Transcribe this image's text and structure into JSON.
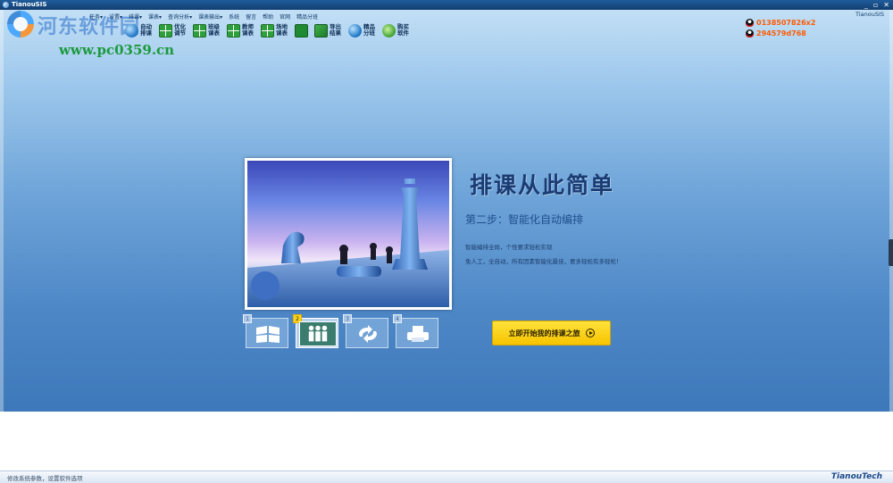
{
  "window": {
    "title": "TianouSIS",
    "brand_top": "TianouSIS",
    "minimize": "_",
    "restore": "▫",
    "close": "✕"
  },
  "watermark": {
    "name": "河东软件园",
    "url": "www.pc0359.cn"
  },
  "menu": {
    "items": [
      "任务▾",
      "设置▾",
      "排课▾",
      "课表▾",
      "查询分析▾",
      "课表输出▾",
      "系统",
      "留言",
      "帮助",
      "官网",
      "精品分班"
    ]
  },
  "toolbar": {
    "items": [
      {
        "label": "自动排课",
        "icon": "globe-icon"
      },
      {
        "label": "优化调节",
        "icon": "grid-icon"
      },
      {
        "label": "班级课表",
        "icon": "grid-icon"
      },
      {
        "label": "教师课表",
        "icon": "grid-icon"
      },
      {
        "label": "场地课表",
        "icon": "grid-icon"
      },
      {
        "label": "",
        "icon": "save-icon"
      },
      {
        "label": "导出结果",
        "icon": "export-icon"
      },
      {
        "label": "精品分班",
        "icon": "globe-icon"
      },
      {
        "label": "购买软件",
        "icon": "green-icon"
      }
    ]
  },
  "contacts": {
    "phone": "0138507826x2",
    "qq": "294579d768"
  },
  "hero": {
    "title": "排课从此简单",
    "step": "第二步：智能化自动编排",
    "desc1": "智能编排全局，个性要求轻松实现",
    "desc2": "免人工，全自动，所有因素智能化最佳，要多轻松有多轻松！",
    "start_button": "立即开始我的排课之旅"
  },
  "steps": [
    {
      "num": "1",
      "icon": "schedule-grid-icon",
      "active": false
    },
    {
      "num": "2",
      "icon": "people-icon",
      "active": true
    },
    {
      "num": "3",
      "icon": "recycle-icon",
      "active": false
    },
    {
      "num": "4",
      "icon": "printer-icon",
      "active": false
    }
  ],
  "status": {
    "text": "修改系统参数，设置软件选项",
    "brand_bottom": "TianouTech"
  },
  "colors": {
    "accent_yellow": "#f7c400",
    "title_blue": "#1b3b73",
    "contact_orange": "#ff5a00"
  }
}
